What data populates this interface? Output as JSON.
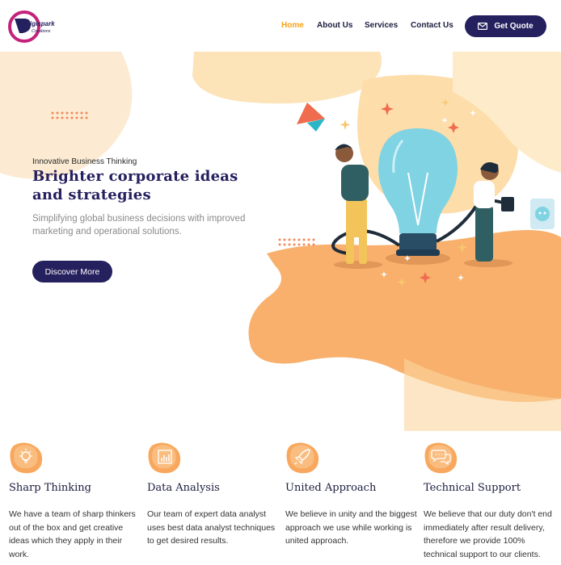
{
  "brand": {
    "logo_text": "igispark",
    "logo_sub": "Creations"
  },
  "nav": {
    "items": [
      {
        "label": "Home"
      },
      {
        "label": "About Us"
      },
      {
        "label": "Services"
      },
      {
        "label": "Contact Us"
      }
    ],
    "quote_label": "Get Quote"
  },
  "hero": {
    "eyebrow": "Innovative Business Thinking",
    "title": "Brighter corporate ideas and strategies",
    "subtitle": "Simplifying global business decisions with improved marketing and operational solutions.",
    "cta_label": "Discover More"
  },
  "features": [
    {
      "title": "Sharp Thinking",
      "text": "We have a team of sharp thinkers out of the box and get creative ideas which they apply in their work.",
      "icon": "lightbulb-icon"
    },
    {
      "title": "Data Analysis",
      "text": "Our team of expert data analyst uses best data analyst techniques to get desired results.",
      "icon": "bar-chart-icon"
    },
    {
      "title": "United Approach",
      "text": "We believe in unity and the biggest approach we use while working is united approach.",
      "icon": "rocket-icon"
    },
    {
      "title": "Technical Support",
      "text": "We believe that our duty don't end immediately after result delivery, therefore we provide 100% technical support to our clients.",
      "icon": "chat-icon"
    }
  ],
  "colors": {
    "accent": "#f5a21b",
    "brand": "#25205e",
    "peach": "#fbe6c6",
    "orange": "#f8b577"
  }
}
